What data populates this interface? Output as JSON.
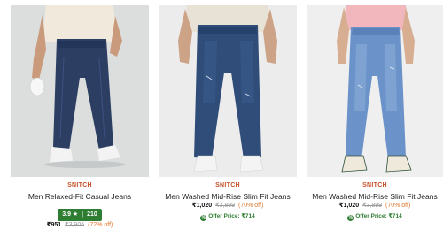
{
  "products": [
    {
      "brand": "SNITCH",
      "title": "Men Relaxed-Fit Casual Jeans",
      "rating": "3.9",
      "rating_star": "★",
      "rating_count": "210",
      "price": "₹951",
      "mrp": "₹3,906",
      "discount": "(72% off)",
      "offer": ""
    },
    {
      "brand": "SNITCH",
      "title": "Men Washed Mid-Rise Slim Fit Jeans",
      "price": "₹1,020",
      "mrp": "₹3,899",
      "discount": "(70% off)",
      "offer": "Offer Price: ₹714"
    },
    {
      "brand": "SNITCH",
      "title": "Men Washed Mid-Rise Slim Fit Jeans",
      "price": "₹1,020",
      "mrp": "₹3,899",
      "discount": "(70% off)",
      "offer": "Offer Price: ₹714"
    }
  ],
  "colors": {
    "brand": "#c5512a",
    "rating_bg": "#2e7d32",
    "discount": "#e0762c",
    "offer": "#2e7d32"
  }
}
